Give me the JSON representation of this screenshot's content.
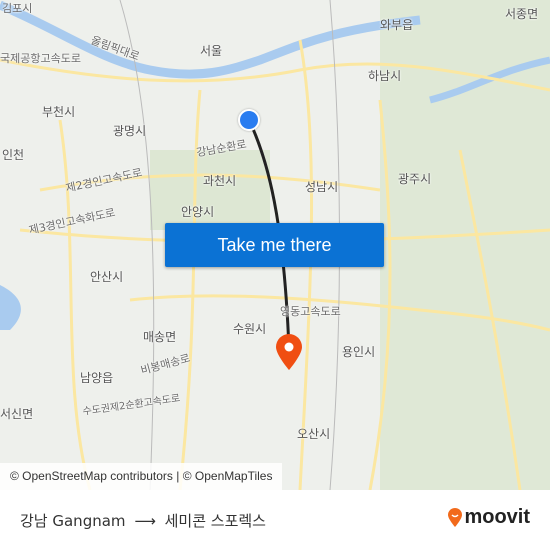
{
  "map": {
    "labels": [
      {
        "text": "김포시",
        "cls": "city"
      },
      {
        "text": "서울",
        "cls": "city"
      },
      {
        "text": "와부읍",
        "cls": "city"
      },
      {
        "text": "서종면",
        "cls": "city"
      },
      {
        "text": "국제공항고속도로",
        "cls": ""
      },
      {
        "text": "올림픽대로",
        "cls": ""
      },
      {
        "text": "하남시",
        "cls": "city"
      },
      {
        "text": "부천시",
        "cls": "city"
      },
      {
        "text": "광명시",
        "cls": "city"
      },
      {
        "text": "인천",
        "cls": "city"
      },
      {
        "text": "강남순환로",
        "cls": ""
      },
      {
        "text": "과천시",
        "cls": "city"
      },
      {
        "text": "성남시",
        "cls": "city"
      },
      {
        "text": "광주시",
        "cls": "city"
      },
      {
        "text": "제2경인고속도로",
        "cls": ""
      },
      {
        "text": "제3경인고속화도로",
        "cls": ""
      },
      {
        "text": "안양시",
        "cls": "city"
      },
      {
        "text": "안산시",
        "cls": "city"
      },
      {
        "text": "영동고속도로",
        "cls": ""
      },
      {
        "text": "매송면",
        "cls": "city"
      },
      {
        "text": "수원시",
        "cls": "city"
      },
      {
        "text": "용인시",
        "cls": "city"
      },
      {
        "text": "남양읍",
        "cls": "city"
      },
      {
        "text": "서신면",
        "cls": "city"
      },
      {
        "text": "오산시",
        "cls": "city"
      },
      {
        "text": "비봉매송로",
        "cls": ""
      },
      {
        "text": "수도권제2순환고속도로",
        "cls": ""
      }
    ],
    "origin_marker_color": "#2a7df0",
    "destination_marker_color": "#f04e12",
    "route_color": "#222222",
    "attribution": "© OpenStreetMap contributors | © OpenMapTiles"
  },
  "cta": {
    "label": "Take me there",
    "color": "#0b72d4"
  },
  "footer": {
    "origin": "강남 Gangnam",
    "arrow": "⟶",
    "destination": "세미콘 스포렉스",
    "brand": "moovit",
    "brand_color": "#f26a1b"
  }
}
